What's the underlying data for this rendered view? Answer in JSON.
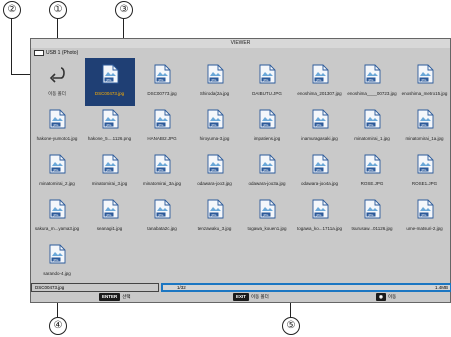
{
  "callouts": [
    "①",
    "②",
    "③",
    "④",
    "⑤"
  ],
  "window": {
    "title": "VIEWER"
  },
  "path": {
    "label": "USB 1 (Photo)"
  },
  "files": [
    {
      "name": "이동 폴더",
      "type": "back"
    },
    {
      "name": "DSC00473.jpg",
      "type": "image",
      "selected": true
    },
    {
      "name": "DSC00773.jpg",
      "type": "image"
    },
    {
      "name": "Shiroda(2a.jpg",
      "type": "image"
    },
    {
      "name": "DAIBUTU.JPG",
      "type": "image"
    },
    {
      "name": "enoshima_201307.jpg",
      "type": "image"
    },
    {
      "name": "enoshima____00723.jpg",
      "type": "image"
    },
    {
      "name": "enoshima_metro15.jpg",
      "type": "image"
    },
    {
      "name": "hakone-yumoto1.jpg",
      "type": "image"
    },
    {
      "name": "hakone_5....1126.png",
      "type": "image"
    },
    {
      "name": "HANABI2.JPG",
      "type": "image"
    },
    {
      "name": "hiroyuma-3.jpg",
      "type": "image"
    },
    {
      "name": "impatiens.jpg",
      "type": "image"
    },
    {
      "name": "inamuragasaki.jpg",
      "type": "image"
    },
    {
      "name": "minatomirai_1.jpg",
      "type": "image"
    },
    {
      "name": "minatomirai_1a.jpg",
      "type": "image"
    },
    {
      "name": "minatomirai_2.jpg",
      "type": "image"
    },
    {
      "name": "minatomirai_3.jpg",
      "type": "image"
    },
    {
      "name": "minatomirai_3a.jpg",
      "type": "image"
    },
    {
      "name": "odawara-joo3.jpg",
      "type": "image"
    },
    {
      "name": "odawara-joo3a.jpg",
      "type": "image"
    },
    {
      "name": "odawara-joo4a.jpg",
      "type": "image"
    },
    {
      "name": "ROSE.JPG",
      "type": "image"
    },
    {
      "name": "ROSE1.JPG",
      "type": "image"
    },
    {
      "name": "sakura_m...yama3.jpg",
      "type": "image"
    },
    {
      "name": "seanagi1.jpg",
      "type": "image"
    },
    {
      "name": "tanabata2c.jpg",
      "type": "image"
    },
    {
      "name": "tenzawaku_3.jpg",
      "type": "image"
    },
    {
      "name": "togawa_kouen1.jpg",
      "type": "image"
    },
    {
      "name": "togawa_ko...1711a.jpg",
      "type": "image"
    },
    {
      "name": "tsurusaw...01126.jpg",
      "type": "image"
    },
    {
      "name": "ume-matsuri-2.jpg",
      "type": "image"
    },
    {
      "name": "sarando-4.jpg",
      "type": "image"
    }
  ],
  "status": {
    "filename": "DSC00473.jpg",
    "count": "1/32",
    "size": "1.4MB"
  },
  "hints": [
    {
      "key": "ENTER",
      "label": "선택"
    },
    {
      "key": "EXIT",
      "label": "이동 폴더"
    },
    {
      "key": "◉",
      "label": "이동"
    }
  ],
  "colors": {
    "selection": "#1f3f74",
    "selected_text": "#ffb000",
    "status_border": "#1b76c2"
  }
}
